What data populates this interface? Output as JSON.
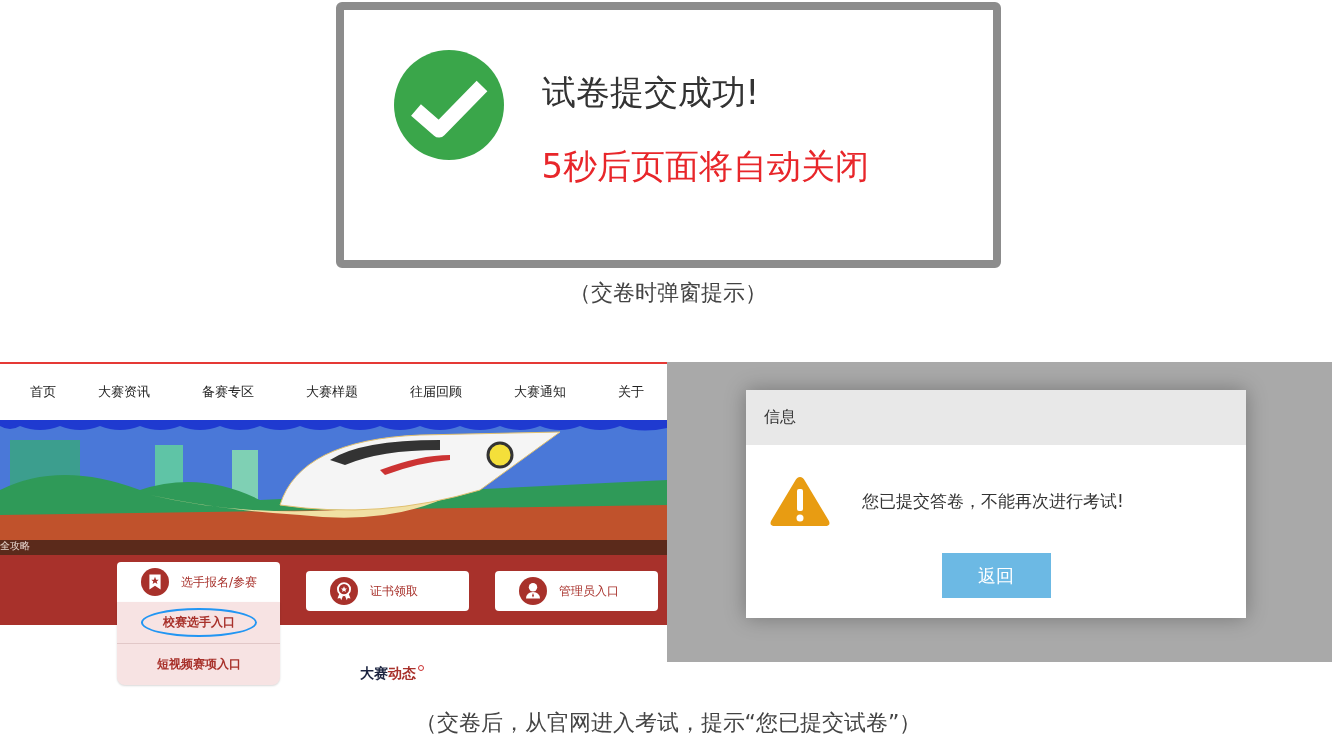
{
  "success_popup": {
    "title": "试卷提交成功!",
    "countdown": "5秒后页面将自动关闭"
  },
  "caption_top": "（交卷时弹窗提示）",
  "website": {
    "nav": [
      {
        "label": "首页"
      },
      {
        "label": "大赛资讯"
      },
      {
        "label": "备赛专区"
      },
      {
        "label": "大赛样题"
      },
      {
        "label": "往届回顾"
      },
      {
        "label": "大赛通知"
      },
      {
        "label": "关于"
      }
    ],
    "banner_caption": "全攻略",
    "entry_buttons": [
      {
        "label": "选手报名/参赛",
        "kind": "register",
        "expanded": true
      },
      {
        "label": "证书领取",
        "kind": "certificate",
        "expanded": false
      },
      {
        "label": "管理员入口",
        "kind": "admin",
        "expanded": false
      }
    ],
    "dropdown": [
      {
        "label": "校赛选手入口",
        "circled": true
      },
      {
        "label": "短视频赛项入口",
        "circled": false
      }
    ],
    "section_heading": "大赛**动态**"
  },
  "info_dialog": {
    "title": "信息",
    "message": "您已提交答卷，不能再次进行考试!",
    "button": "返回"
  },
  "caption_bottom": "（交卷后，从官网进入考试，提示“您已提交试卷”）"
}
